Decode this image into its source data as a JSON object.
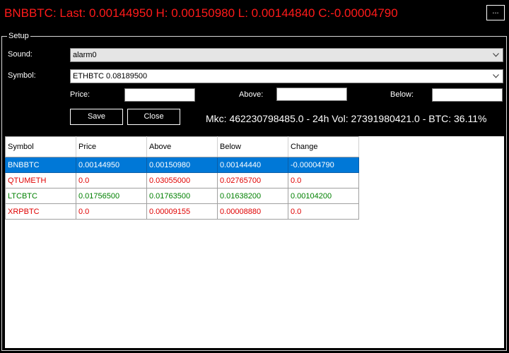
{
  "header": {
    "ticker": "BNBBTC: Last: 0.00144950 H: 0.00150980 L: 0.00144840 C:-0.00004790",
    "menu_label": "..."
  },
  "setup": {
    "legend": "Setup",
    "sound_label": "Sound:",
    "sound_value": "alarm0",
    "symbol_label": "Symbol:",
    "symbol_value": "ETHBTC 0.08189500",
    "price_label": "Price:",
    "price_value": "",
    "above_label": "Above:",
    "above_value": "",
    "below_label": "Below:",
    "below_value": "",
    "save_label": "Save",
    "close_label": "Close",
    "stats": "Mkc: 462230798485.0 - 24h Vol: 27391980421.0 - BTC: 36.11%"
  },
  "grid": {
    "columns": [
      "Symbol",
      "Price",
      "Above",
      "Below",
      "Change"
    ],
    "rows": [
      {
        "cells": [
          "BNBBTC",
          "0.00144950",
          "0.00150980",
          "0.00144440",
          "-0.00004790"
        ],
        "state": "selected"
      },
      {
        "cells": [
          "QTUMETH",
          "0.0",
          "0.03055000",
          "0.02765700",
          "0.0"
        ],
        "state": "red"
      },
      {
        "cells": [
          "LTCBTC",
          "0.01756500",
          "0.01763500",
          "0.01638200",
          "0.00104200"
        ],
        "state": "green"
      },
      {
        "cells": [
          "XRPBTC",
          "0.0",
          "0.00009155",
          "0.00008880",
          "0.0"
        ],
        "state": "red"
      }
    ]
  },
  "colors": {
    "ticker": "#ff1a1a",
    "selection": "#0078d7",
    "negative": "#e00000",
    "positive": "#008000"
  },
  "icons": {
    "dropdown": "chevron-down-icon"
  }
}
